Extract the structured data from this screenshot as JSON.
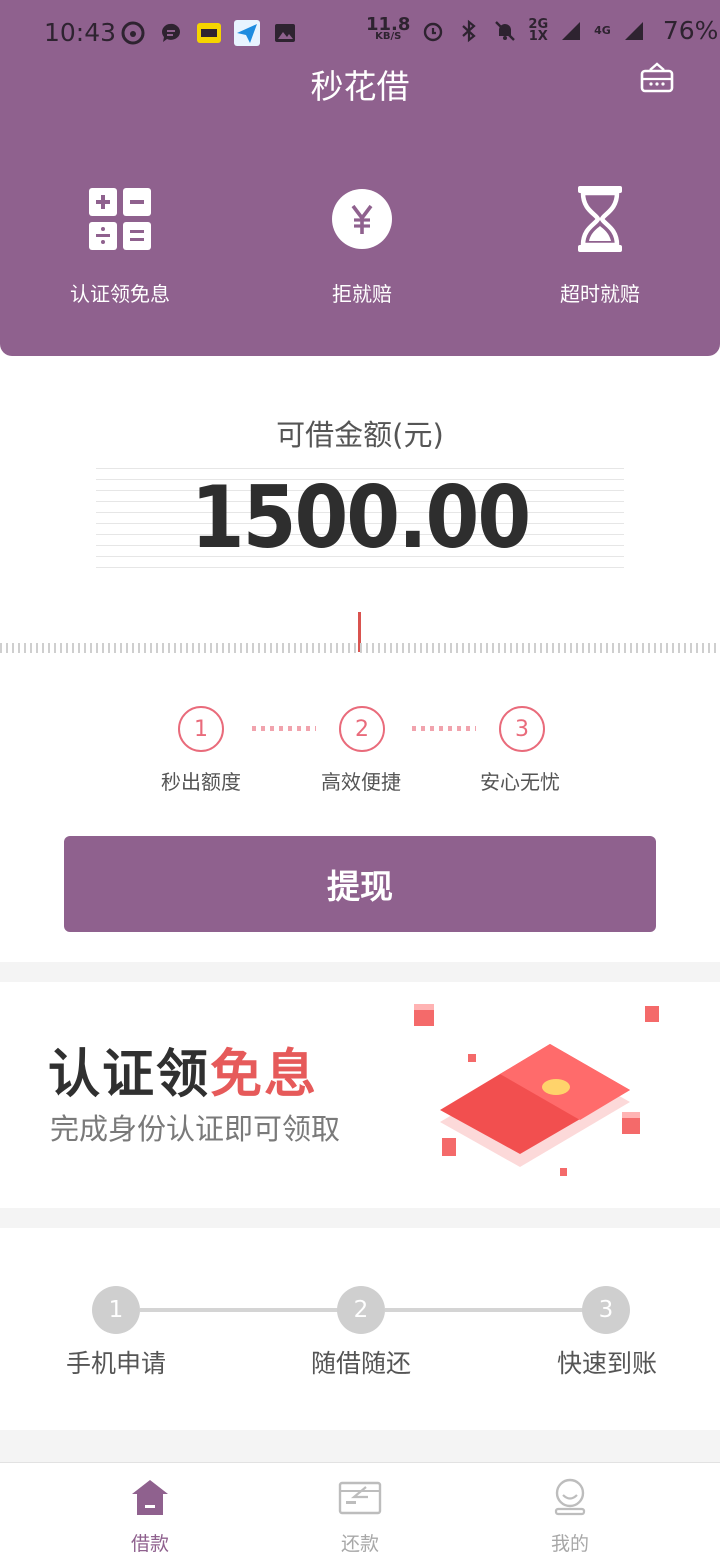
{
  "status_bar": {
    "time": "10:43",
    "net_speed_value": "11.8",
    "net_speed_unit": "KB/S",
    "signal_label_top": "2G",
    "signal_label_bottom": "1X",
    "signal_4g": "4G",
    "battery": "76%"
  },
  "header": {
    "title": "秒花借",
    "features": [
      {
        "label": "认证领免息",
        "icon": "calculator-icon"
      },
      {
        "label": "拒就赔",
        "icon": "yuan-coin-icon"
      },
      {
        "label": "超时就赔",
        "icon": "hourglass-icon"
      }
    ]
  },
  "loan": {
    "label": "可借金额(元)",
    "amount": "1500.00"
  },
  "steps_top": [
    {
      "num": "1",
      "label": "秒出额度"
    },
    {
      "num": "2",
      "label": "高效便捷"
    },
    {
      "num": "3",
      "label": "安心无忧"
    }
  ],
  "withdraw_label": "提现",
  "banner": {
    "title_main": "认证领",
    "title_highlight": "免息",
    "subtitle": "完成身份认证即可领取"
  },
  "steps_bottom": [
    {
      "num": "1",
      "label": "手机申请"
    },
    {
      "num": "2",
      "label": "随借随还"
    },
    {
      "num": "3",
      "label": "快速到账"
    }
  ],
  "tabs": [
    {
      "label": "借款",
      "icon": "home-icon",
      "active": true
    },
    {
      "label": "还款",
      "icon": "wallet-icon",
      "active": false
    },
    {
      "label": "我的",
      "icon": "profile-icon",
      "active": false
    }
  ],
  "colors": {
    "brand": "#8f618e",
    "step_accent": "#e96b7b",
    "banner_highlight": "#e65a5a",
    "inactive_step": "#cfcfcf"
  }
}
